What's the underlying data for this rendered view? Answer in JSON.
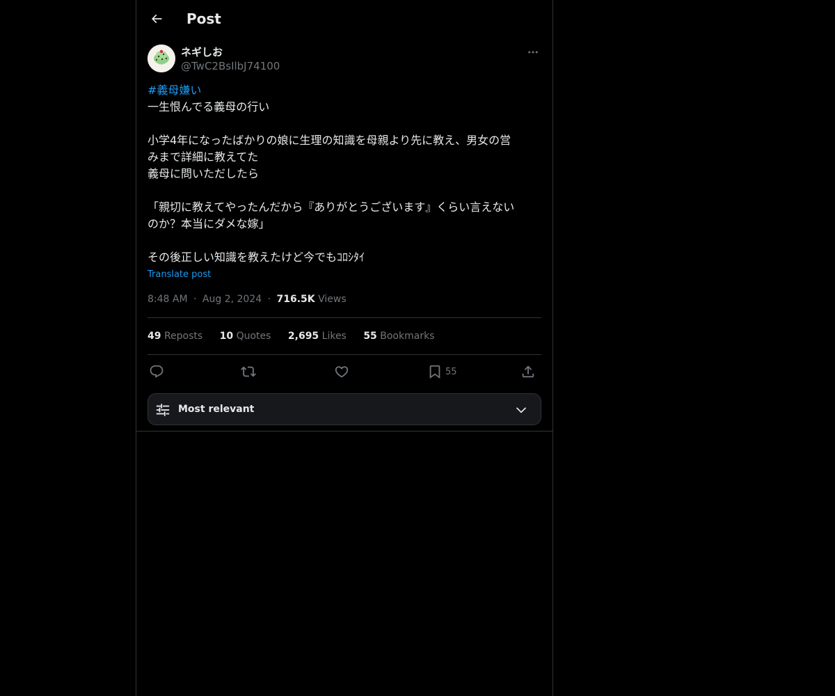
{
  "header": {
    "title": "Post",
    "back_icon": "arrow-left-icon"
  },
  "author": {
    "display_name": "ネギしお",
    "handle": "@TwC2BsIlbJ74100",
    "avatar_icon": "mint-ice-cream-avatar",
    "more_icon": "more-horizontal-icon"
  },
  "post": {
    "hashtag": "#義母嫌い",
    "lines": [
      "一生恨んでる義母の行い",
      "",
      "小学4年になったばかりの娘に生理の知識を母親より先に教え、男女の営",
      "みまで詳細に教えてた",
      "義母に問いただしたら",
      "",
      "「親切に教えてやったんだから『ありがとうございます』くらい言えない",
      "のか？本当にダメな嫁」",
      "",
      "その後正しい知識を教えたけど今でもｺﾛｼﾀｲ"
    ],
    "translate_label": "Translate post",
    "time": "8:48 AM",
    "date": "Aug 2, 2024",
    "separator": "·",
    "views_count": "716.5K",
    "views_label": "Views"
  },
  "stats": {
    "reposts_count": "49",
    "reposts_label": "Reposts",
    "quotes_count": "10",
    "quotes_label": "Quotes",
    "likes_count": "2,695",
    "likes_label": "Likes",
    "bookmarks_count": "55",
    "bookmarks_label": "Bookmarks"
  },
  "actions": {
    "reply_icon": "reply-icon",
    "repost_icon": "repost-icon",
    "like_icon": "heart-icon",
    "bookmark_icon": "bookmark-icon",
    "bookmark_count": "55",
    "share_icon": "share-icon"
  },
  "sort": {
    "label": "Most relevant",
    "icon": "sliders-icon",
    "chevron": "chevron-down-icon"
  },
  "colors": {
    "background": "#000000",
    "text": "#e7e9ea",
    "secondary": "#71767b",
    "accent": "#1d9bf0",
    "border": "#2f3336"
  }
}
